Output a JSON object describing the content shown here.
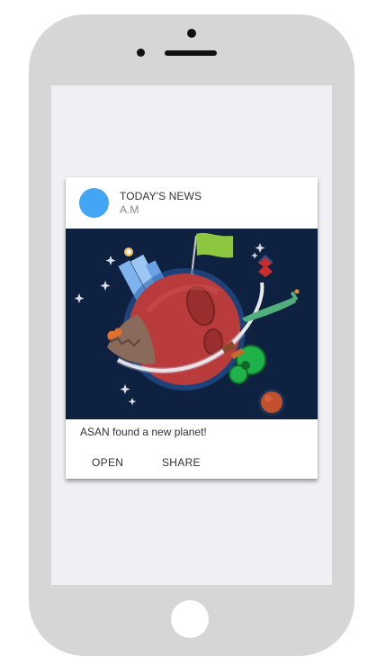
{
  "card": {
    "title": "TODAY'S NEWS",
    "subtitle": "A.M",
    "avatar_color": "#42a5f5",
    "image_icon": "planet-illustration",
    "text": "ASAN found a new planet!",
    "actions": {
      "open_label": "OPEN",
      "share_label": "SHARE"
    }
  },
  "colors": {
    "device_frame": "#d6d6d6",
    "screen_background": "#efeff4",
    "media_background": "#0f2140"
  }
}
